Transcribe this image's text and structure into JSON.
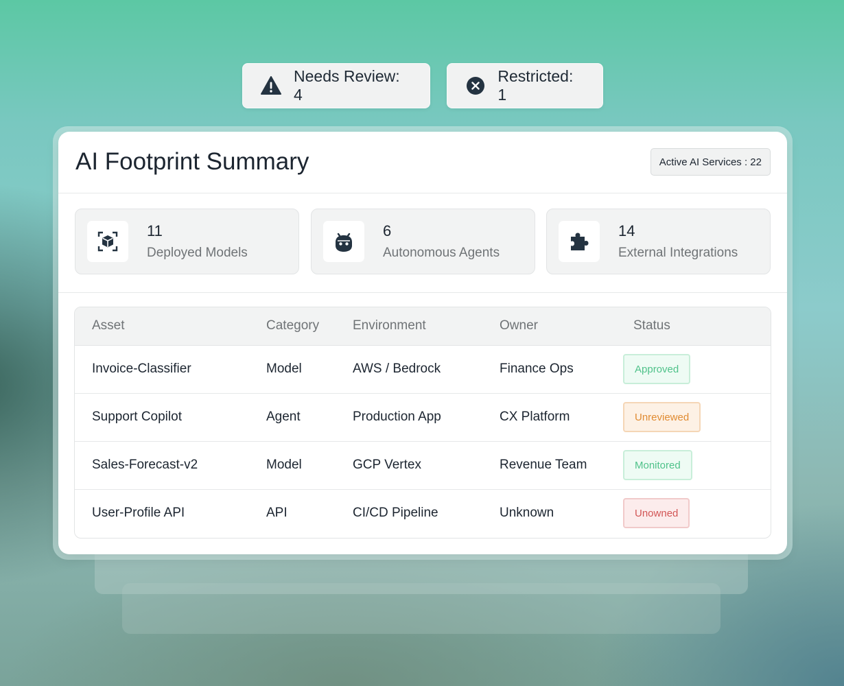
{
  "alerts": {
    "needs_review": "Needs Review: 4",
    "restricted": "Restricted: 1"
  },
  "card": {
    "title": "AI Footprint Summary",
    "active_services": "Active AI Services : 22"
  },
  "stats": [
    {
      "value": "11",
      "label": "Deployed Models",
      "icon": "cube-icon"
    },
    {
      "value": "6",
      "label": "Autonomous Agents",
      "icon": "robot-icon"
    },
    {
      "value": "14",
      "label": "External Integrations",
      "icon": "puzzle-icon"
    }
  ],
  "table": {
    "headers": [
      "Asset",
      "Category",
      "Environment",
      "Owner",
      "Status"
    ],
    "rows": [
      {
        "asset": "Invoice-Classifier",
        "category": "Model",
        "environment": "AWS / Bedrock",
        "owner": "Finance Ops",
        "status": "Approved",
        "status_color": "#4fc28a"
      },
      {
        "asset": "Support Copilot",
        "category": "Agent",
        "environment": "Production App",
        "owner": "CX Platform",
        "status": "Unreviewed",
        "status_color": "#e08b32"
      },
      {
        "asset": "Sales-Forecast-v2",
        "category": "Model",
        "environment": "GCP Vertex",
        "owner": "Revenue Team",
        "status": "Monitored",
        "status_color": "#4fc28a"
      },
      {
        "asset": "User-Profile API",
        "category": "API",
        "environment": "CI/CD Pipeline",
        "owner": "Unknown",
        "status": "Unowned",
        "status_color": "#d25555"
      }
    ]
  },
  "colors": {
    "icon_dark": "#243341",
    "text_primary": "#1c2530",
    "text_muted": "#6f7376"
  }
}
